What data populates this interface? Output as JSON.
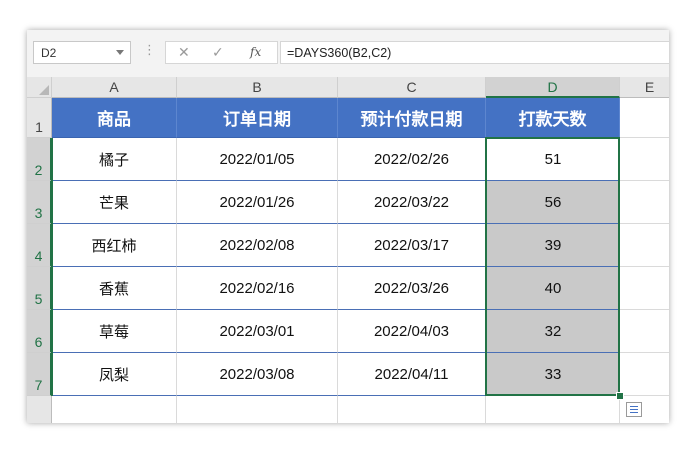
{
  "name_box": "D2",
  "formula_bar": {
    "cancel_icon": "x-icon",
    "enter_icon": "check-icon",
    "fx_label": "fx",
    "formula": "=DAYS360(B2,C2)"
  },
  "columns": [
    "A",
    "B",
    "C",
    "D",
    "E"
  ],
  "rows": [
    "1",
    "2",
    "3",
    "4",
    "5",
    "6",
    "7"
  ],
  "table": {
    "headers": [
      "商品",
      "订单日期",
      "预计付款日期",
      "打款天数"
    ],
    "data": [
      [
        "橘子",
        "2022/01/05",
        "2022/02/26",
        "51"
      ],
      [
        "芒果",
        "2022/01/26",
        "2022/03/22",
        "56"
      ],
      [
        "西红柿",
        "2022/02/08",
        "2022/03/17",
        "39"
      ],
      [
        "香蕉",
        "2022/02/16",
        "2022/03/26",
        "40"
      ],
      [
        "草莓",
        "2022/03/01",
        "2022/04/03",
        "32"
      ],
      [
        "凤梨",
        "2022/03/08",
        "2022/04/11",
        "33"
      ]
    ]
  },
  "colors": {
    "header_fill": "#4472c4",
    "selection": "#217346",
    "selected_fill": "#c9c9c9"
  }
}
